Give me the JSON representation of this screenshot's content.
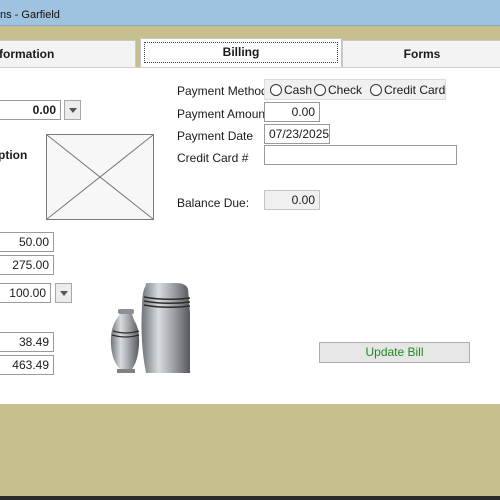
{
  "window": {
    "title": "ns - Garfield"
  },
  "tabs": [
    {
      "label": "formation",
      "active": false
    },
    {
      "label": "Billing",
      "active": true
    },
    {
      "label": "Forms",
      "active": false
    }
  ],
  "left": {
    "top_value": "0.00",
    "section_label": "ption",
    "amount_1": "50.00",
    "amount_2": "275.00",
    "amount_3": "100.00",
    "amount_4": "38.49",
    "amount_5": "463.49"
  },
  "payment": {
    "method_label": "Payment Method",
    "methods": [
      "Cash",
      "Check",
      "Credit Card"
    ],
    "amount_label": "Payment Amount",
    "amount_value": "0.00",
    "date_label": "Payment Date",
    "date_value": "07/23/2025",
    "card_label": "Credit Card #",
    "card_value": "",
    "balance_label": "Balance Due:",
    "balance_value": "0.00"
  },
  "actions": {
    "update_label": "Update Bill"
  },
  "colors": {
    "accent_text": "#1e8a1e",
    "background": "#c8bf8f",
    "titlebar": "#9fc3de"
  }
}
